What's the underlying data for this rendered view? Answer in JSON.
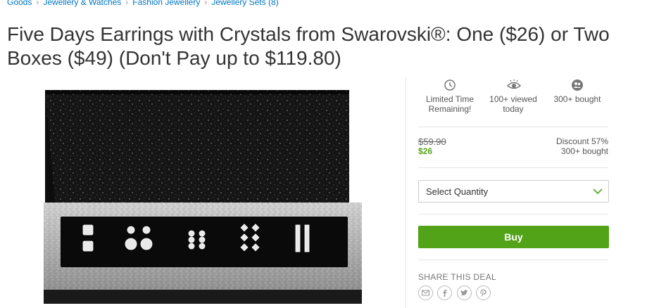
{
  "breadcrumb": {
    "items": [
      "Goods",
      "Jewellery & Watches",
      "Fashion Jewellery",
      "Jewellery Sets (8)"
    ]
  },
  "deal": {
    "title": "Five Days Earrings with Crystals from Swarovski®: One ($26) or Two Boxes ($49) (Don't Pay up to $119.80)"
  },
  "stats": {
    "limited": "Limited Time Remaining!",
    "viewed": "100+ viewed today",
    "bought": "300+ bought"
  },
  "pricing": {
    "original": "$59.90",
    "price": "$26",
    "discount": "Discount 57%",
    "bought": "300+ bought"
  },
  "quantity": {
    "label": "Select Quantity"
  },
  "buy": {
    "label": "Buy"
  },
  "share": {
    "label": "SHARE THIS DEAL",
    "icons": [
      "email-icon",
      "facebook-icon",
      "twitter-icon",
      "pinterest-icon"
    ]
  },
  "colors": {
    "accent": "#53a318",
    "link": "#0076c0"
  }
}
